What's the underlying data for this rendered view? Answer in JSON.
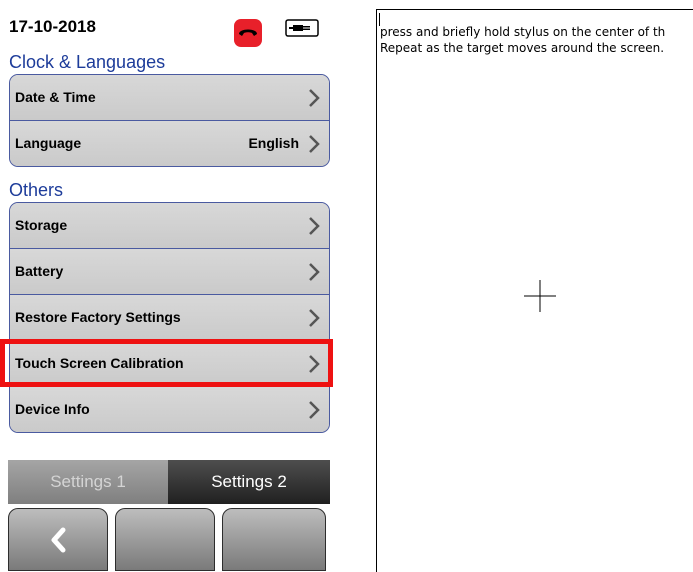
{
  "device": {
    "date": "17-10-2018",
    "icons": {
      "phone": "phone-hangup-icon",
      "power": "power-plug-icon",
      "chevron": "chevron-right-icon",
      "back": "back-arrow-icon"
    },
    "section_clock": "Clock & Languages",
    "date_time": "Date & Time",
    "language": "Language",
    "language_value": "English",
    "section_others": "Others",
    "storage": "Storage",
    "battery": "Battery",
    "restore": "Restore Factory Settings",
    "touch_calibration": "Touch Screen Calibration",
    "device_info": "Device Info",
    "tab1": "Settings 1",
    "tab2": "Settings 2",
    "colors": {
      "accent": "#1d3c9a",
      "highlight": "#ee1111",
      "phone": "#e8202a"
    }
  },
  "calibration": {
    "line1": "press and briefly hold stylus on the center of th",
    "line2": "Repeat as the target moves around the screen."
  }
}
